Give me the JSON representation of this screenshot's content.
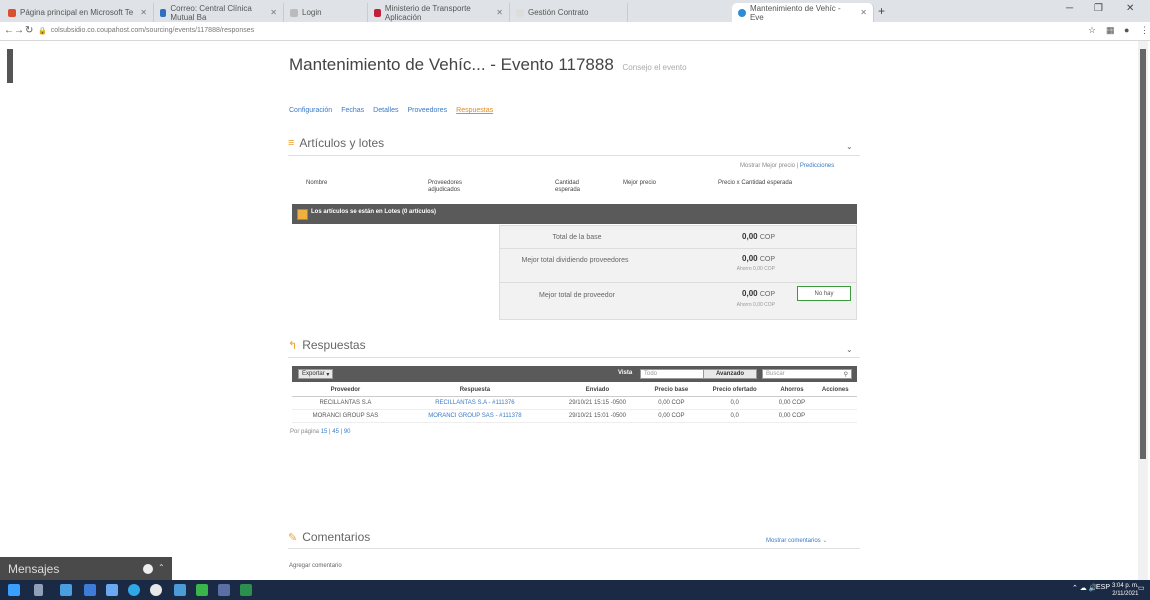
{
  "browser": {
    "tabs": [
      {
        "label": "Página principal en Microsoft Te"
      },
      {
        "label": "Correo: Central Clínica Mutual Ba"
      },
      {
        "label": "Login"
      },
      {
        "label": "Ministerio de Transporte Aplicación"
      },
      {
        "label": "Gestión Contrato"
      },
      {
        "label": "Mantenimiento de Vehíc - Eve"
      }
    ],
    "url": "colsubsidio.co.coupahost.com/sourcing/events/117888/responses"
  },
  "page": {
    "title": "Mantenimiento de Vehíc... - Evento 117888",
    "title_suffix": "Consejo el evento",
    "tabs": [
      "Configuración",
      "Fechas",
      "Detalles",
      "Proveedores",
      "Respuestas"
    ],
    "active_tab": "Respuestas"
  },
  "articulos": {
    "heading": "Artículos y lotes",
    "right_link_prefix": "Mostrar Mejor precio",
    "right_link": "Predicciones",
    "columns": [
      "Nombre",
      "Proveedores adjudicados",
      "Cantidad esperada",
      "Mejor precio",
      "Precio x Cantidad esperada"
    ],
    "bar_text": "Los artículos se están en Lotes (0 artículos)",
    "summary": [
      {
        "label": "Total de la base",
        "value": "0,00",
        "currency": "COP",
        "sub": ""
      },
      {
        "label": "Mejor total dividiendo proveedores",
        "value": "0,00",
        "currency": "COP",
        "sub": "Ahorro 0,00 COP"
      },
      {
        "label": "Mejor total de proveedor",
        "value": "0,00",
        "currency": "COP",
        "sub": "Ahorro 0,00 COP",
        "button": "No hay"
      }
    ]
  },
  "respuestas": {
    "heading": "Respuestas",
    "export_label": "Exportar",
    "view_label": "Vista",
    "view_value": "Todo",
    "advanced_label": "Avanzado",
    "search_placeholder": "Buscar",
    "columns": [
      "Proveedor",
      "Respuesta",
      "Enviado",
      "Precio base",
      "Precio ofertado",
      "Ahorros",
      "Acciones"
    ],
    "rows": [
      {
        "proveedor": "RECILLANTAS S.A",
        "respuesta": "RECILLANTAS S.A - #111376",
        "enviado": "29/10/21 15:15 -0500",
        "precio_base": "0,00 COP",
        "precio_ofertado": "0,0",
        "ahorros": "0,00 COP",
        "acciones": ""
      },
      {
        "proveedor": "MORANCI GROUP SAS",
        "respuesta": "MORANCI GROUP SAS - #111378",
        "enviado": "29/10/21 15:01 -0500",
        "precio_base": "0,00 COP",
        "precio_ofertado": "0,0",
        "ahorros": "0,00 COP",
        "acciones": ""
      }
    ],
    "per_page_label": "Por página",
    "per_page_options": "15 | 45 | 90"
  },
  "comentarios": {
    "heading": "Comentarios",
    "right_link": "Mostrar comentarios",
    "add_label": "Agregar comentario"
  },
  "chat": {
    "label": "Mensajes"
  },
  "taskbar": {
    "time": "3:04 p. m.",
    "date": "2/11/2021",
    "lang": "ESP"
  },
  "colors": {
    "accent_orange": "#e58a1f",
    "link_blue": "#3a7bc8",
    "dark_bar": "#5a5a5a",
    "taskbar": "#1b2a44"
  }
}
